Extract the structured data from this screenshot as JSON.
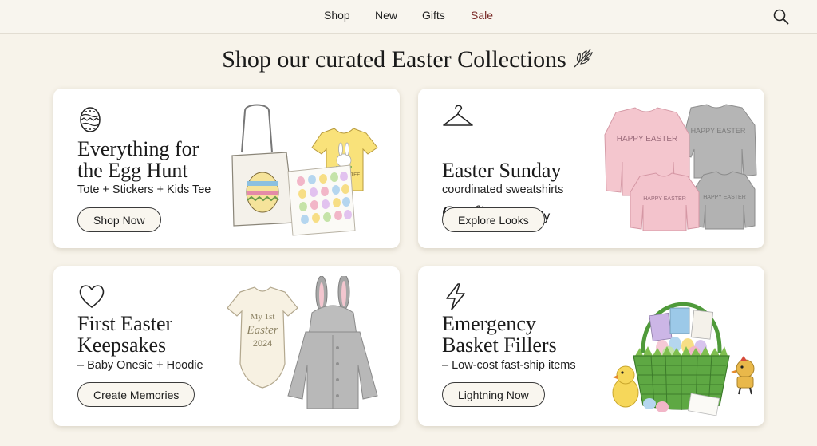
{
  "nav": {
    "items": [
      {
        "label": "Shop"
      },
      {
        "label": "New"
      },
      {
        "label": "Gifts"
      },
      {
        "label": "Sale"
      }
    ],
    "search_icon": "search-icon"
  },
  "headline": "Shop our curated Easter Collections",
  "cards": [
    {
      "icon": "easter-egg-icon",
      "title": "Everything for\nthe Egg Hunt",
      "subtitle": "Tote + Stickers + Kids Tee",
      "button": "Shop Now",
      "tee_text": "GRAPHIC TEE"
    },
    {
      "icon": "hanger-icon",
      "title_line1": "Easter Sunday",
      "title_line2": "Outfit",
      "title_dash": " – ",
      "title_inline_sub": "Family",
      "subtitle": "coordinated sweatshirts",
      "button": "Explore Looks",
      "sweatshirt_text": "HAPPY EASTER"
    },
    {
      "icon": "heart-icon",
      "title": "First Easter\nKeepsakes",
      "subtitle": "– Baby Onesie + Hoodie",
      "button": "Create Memories",
      "onesie_line1": "My 1st",
      "onesie_line2": "Easter",
      "onesie_line3": "2024"
    },
    {
      "icon": "lightning-icon",
      "title": "Emergency\nBasket Fillers",
      "subtitle": "– Low-cost fast-ship items",
      "button": "Lightning Now"
    }
  ],
  "colors": {
    "background": "#f7f3ea",
    "sale": "#7a2a27",
    "card": "#ffffff",
    "button_bg": "#f9f6ef",
    "pink": "#f4c7cf",
    "gray": "#b9b9b9",
    "yellow": "#f8e27e",
    "basket_green": "#4f9a3a"
  }
}
